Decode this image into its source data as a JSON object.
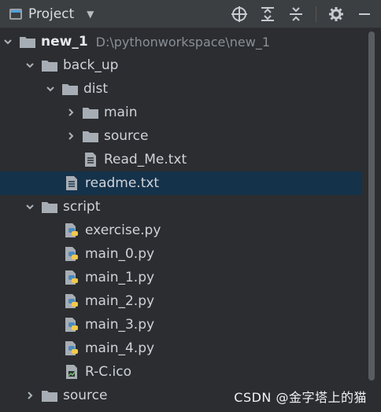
{
  "toolbar": {
    "title": "Project",
    "icons": [
      "project-view-icon",
      "chevron-down-icon",
      "locate-file-icon",
      "expand-all-icon",
      "collapse-all-icon",
      "gear-icon",
      "minimize-icon"
    ]
  },
  "tree": {
    "root": {
      "name": "new_1",
      "path": "D:\\pythonworkspace\\new_1"
    },
    "back_up": "back_up",
    "dist": "dist",
    "main": "main",
    "source_dist": "source",
    "read_me": "Read_Me.txt",
    "readme": "readme.txt",
    "script": "script",
    "exercise": "exercise.py",
    "main_0": "main_0.py",
    "main_1": "main_1.py",
    "main_2": "main_2.py",
    "main_3": "main_3.py",
    "main_4": "main_4.py",
    "rc": "R-C.ico",
    "source_root": "source"
  },
  "watermark": "CSDN @金字塔上的猫",
  "colors": {
    "background": "#2b2d30",
    "toolbar": "#3c3f41",
    "selection": "#15324b",
    "folder": "#9aa0a6",
    "python_blue": "#4b8bbe",
    "python_yellow": "#f2c94c"
  }
}
